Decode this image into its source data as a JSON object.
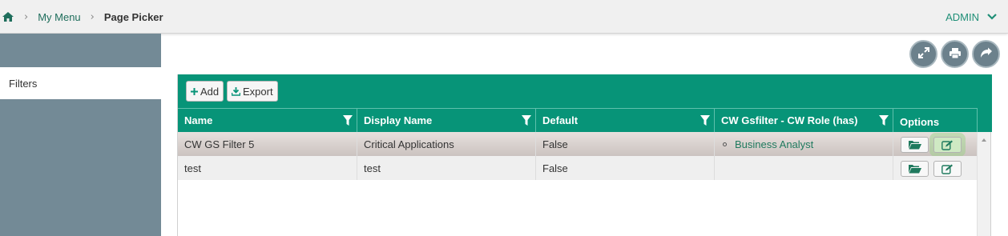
{
  "breadcrumb": {
    "home_icon": "home-icon",
    "items": [
      {
        "label": "My Menu"
      },
      {
        "label": "Page Picker"
      }
    ]
  },
  "user": {
    "name": "ADMIN"
  },
  "sidebar": {
    "items": [
      {
        "label": "Filters"
      }
    ]
  },
  "actions": {
    "icons": [
      "expand-icon",
      "print-icon",
      "share-icon"
    ]
  },
  "toolbar": {
    "add_label": "Add",
    "export_label": "Export"
  },
  "table": {
    "columns": [
      "Name",
      "Display Name",
      "Default",
      "CW Gsfilter - CW Role (has)",
      "Options"
    ],
    "rows": [
      {
        "name": "CW GS Filter 5",
        "display_name": "Critical Applications",
        "default": "False",
        "roles": [
          "Business Analyst"
        ]
      },
      {
        "name": "test",
        "display_name": "test",
        "default": "False",
        "roles": []
      }
    ]
  },
  "colors": {
    "accent": "#079478",
    "sidebar": "#738a96"
  }
}
